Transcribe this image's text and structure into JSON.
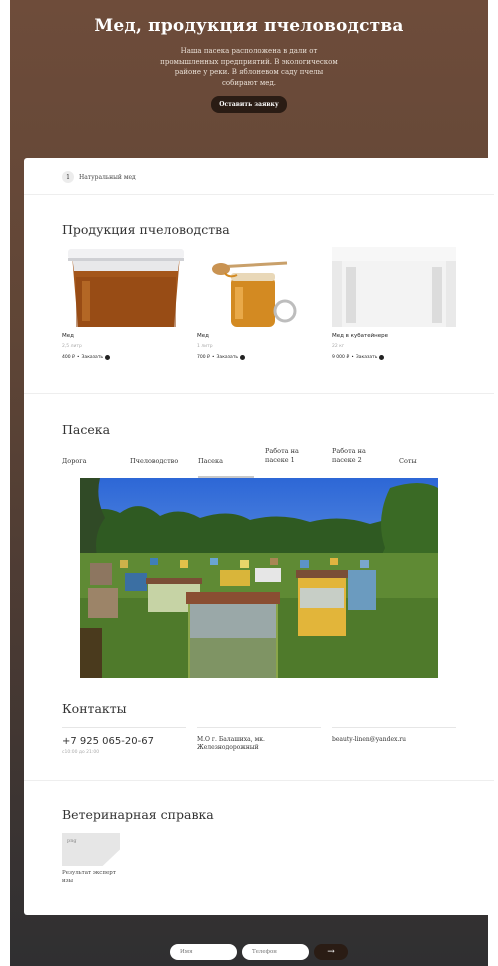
{
  "hero": {
    "title": "Мед, продукция пчеловодства",
    "description": "Наша пасека расположена в дали от промышленных предприятий. В экологическом районе у реки. В яблоневом саду пчелы собирают мед.",
    "cta": "Оставить заявку"
  },
  "breadcrumb": {
    "number": "1",
    "label": "Натуральный мед"
  },
  "products_section": {
    "title": "Продукция пчеловодства",
    "items": [
      {
        "name": "Мед",
        "qty": "2,5 литр",
        "price": "400 ₽",
        "separator": "•",
        "order": "Заказать"
      },
      {
        "name": "Мед",
        "qty": "1 литр",
        "price": "700 ₽",
        "separator": "•",
        "order": "Заказать"
      },
      {
        "name": "Мед в кубатейнере",
        "qty": "22 кг",
        "price": "9 000 ₽",
        "separator": "•",
        "order": "Заказать"
      }
    ]
  },
  "apiary_section": {
    "title": "Пасека",
    "tabs": [
      "Дорога",
      "Пчеловодство",
      "Пасека",
      "Работа на пасеке 1",
      "Работа на пасеке 2",
      "Соты"
    ],
    "active_tab": "Пасека"
  },
  "contacts": {
    "title": "Контакты",
    "phone": "+7 925 065-20-67",
    "hours": "с10:00 до 21:00",
    "address": "М.О г. Балашиха, мк. Железнодорожный",
    "email": "beauty-linen@yandex.ru"
  },
  "vet_section": {
    "title": "Ветеринарная справка",
    "file_ext": "png",
    "file_name": "Результат эксперт изы"
  },
  "footer_form": {
    "name_placeholder": "Имя",
    "phone_placeholder": "Телефон",
    "send_glyph": "→"
  },
  "colors": {
    "hero_brown": "#6e4c3a",
    "bottom_dark": "#2f2f31",
    "button_dark": "#2a1c14",
    "honey": "#a45a16"
  }
}
